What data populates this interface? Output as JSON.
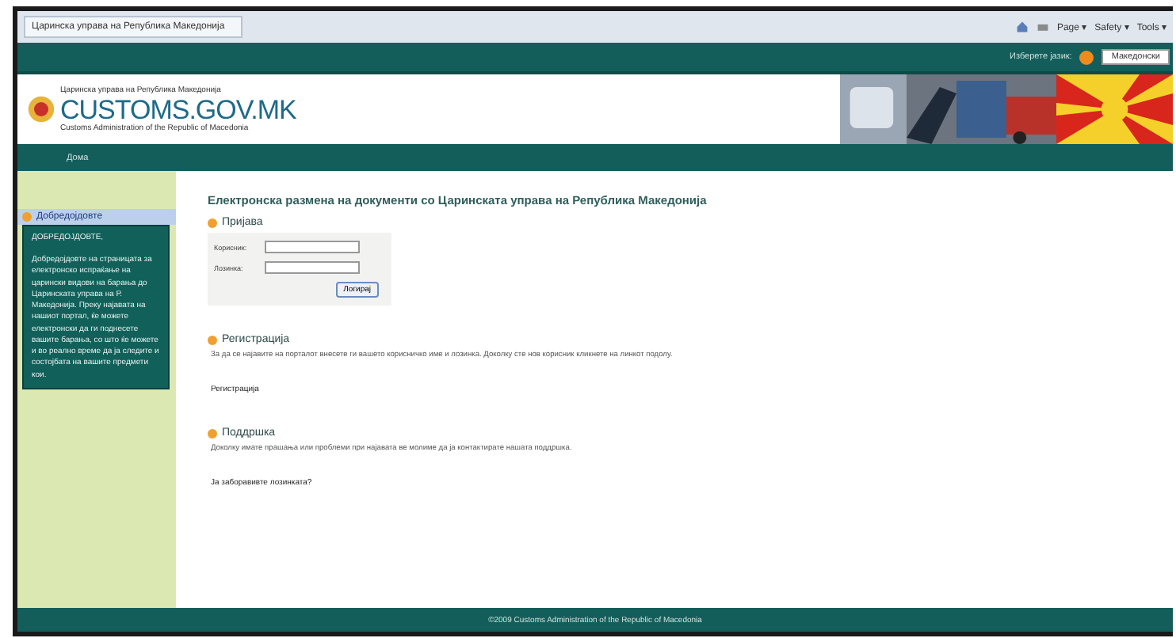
{
  "browser": {
    "tab_title": "Царинска управа на Република Македонија",
    "toolbar": [
      "Page ▾",
      "Safety ▾",
      "Tools ▾"
    ]
  },
  "top_bar": {
    "language_label": "Изберете јазик:",
    "language_value": "Македонски"
  },
  "header": {
    "org_name": "Царинска управа на Република Македонија",
    "logo_text": "CUSTOMS.GOV.MK",
    "subtitle": "Customs Administration of the Republic of Macedonia"
  },
  "nav": [
    {
      "label": "Дома",
      "selected": false
    }
  ],
  "sidebar": {
    "title": "Добредојдовте",
    "heading": "ДОБРЕДОЈДОВТЕ,",
    "text": "Добредојдовте на страницата за електронско испраќање на царински видови на барања до Царинската управа на Р. Македонија. Преку најавата на нашиот портал, ќе можете електронски да ги поднесете вашите барања, со што ќе можете и во реално време да ја следите и состојбата на вашите предмети кои."
  },
  "main": {
    "title": "Електронска размена на документи со Царинската управа на Република Македонија",
    "login": {
      "heading": "Пријава",
      "fields": [
        {
          "label": "Корисник:"
        },
        {
          "label": "Лозинка:"
        }
      ],
      "button": "Логирај"
    },
    "sections": [
      {
        "heading": "Регистрација",
        "text": "За да се најавите на порталот внесете ги вашето корисничко име и лозинка. Доколку сте нов корисник кликнете на линкот подолу.",
        "link": "Регистрација"
      },
      {
        "heading": "Поддршка",
        "text": "Доколку имате прашања или проблеми при најавата ве молиме да ја контактирате нашата поддршка.",
        "link": "Ја заборавивте лозинката?"
      }
    ]
  },
  "footer": "©2009 Customs Administration of the Republic of Macedonia"
}
